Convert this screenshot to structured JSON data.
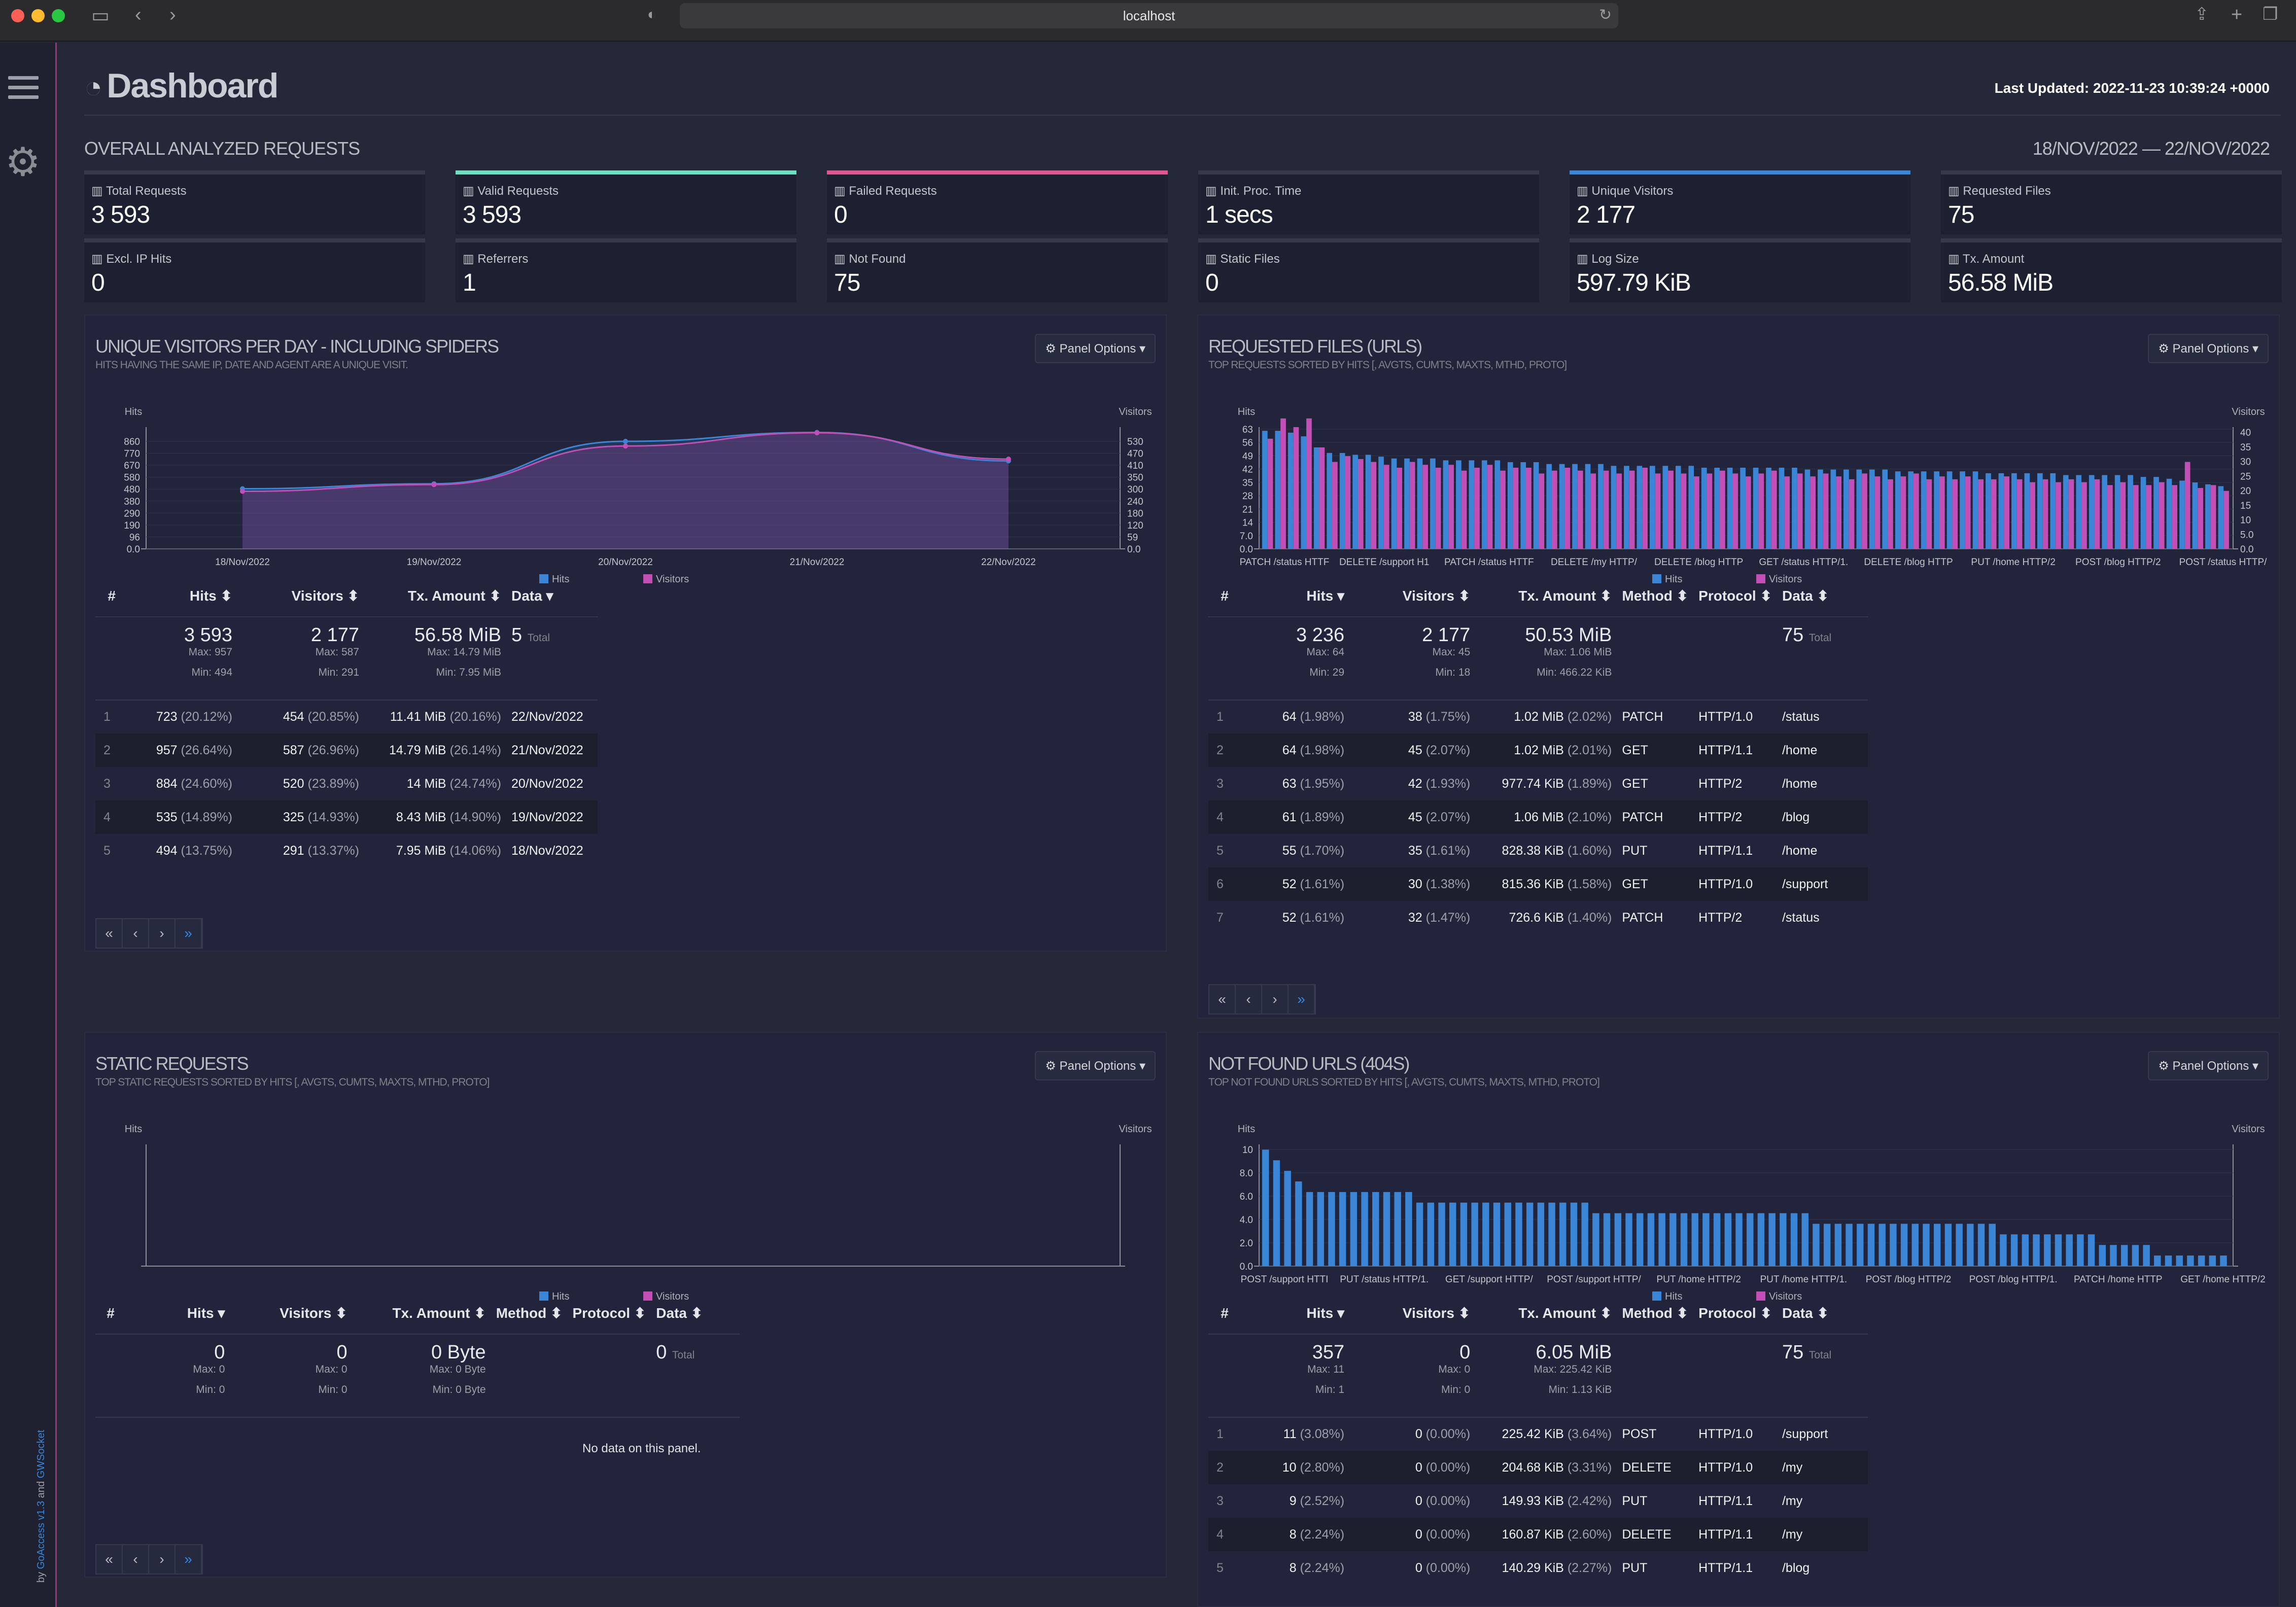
{
  "browser": {
    "url": "localhost"
  },
  "sidebar": {
    "credit_prefix": "by ",
    "credit_app": "GoAccess",
    "credit_version": "v1.3",
    "credit_and": " and ",
    "credit_ws": "GWSocket"
  },
  "header": {
    "title": "Dashboard",
    "last_updated": "Last Updated: 2022-11-23 10:39:24 +0000"
  },
  "overall": {
    "title": "OVERALL ANALYZED REQUESTS",
    "date_range": "18/NOV/2022 — 22/NOV/2022",
    "cards": [
      {
        "label": "Total Requests",
        "value": "3 593",
        "accent": "#363a4c"
      },
      {
        "label": "Valid Requests",
        "value": "3 593",
        "accent": "#6ee0bd"
      },
      {
        "label": "Failed Requests",
        "value": "0",
        "accent": "#e0578d"
      },
      {
        "label": "Init. Proc. Time",
        "value": "1 secs",
        "accent": "#363a4c"
      },
      {
        "label": "Unique Visitors",
        "value": "2 177",
        "accent": "#3a85d6"
      },
      {
        "label": "Requested Files",
        "value": "75",
        "accent": "#363a4c"
      },
      {
        "label": "Excl. IP Hits",
        "value": "0",
        "accent": "#363a4c"
      },
      {
        "label": "Referrers",
        "value": "1",
        "accent": "#363a4c"
      },
      {
        "label": "Not Found",
        "value": "75",
        "accent": "#363a4c"
      },
      {
        "label": "Static Files",
        "value": "0",
        "accent": "#363a4c"
      },
      {
        "label": "Log Size",
        "value": "597.79 KiB",
        "accent": "#363a4c"
      },
      {
        "label": "Tx. Amount",
        "value": "56.58 MiB",
        "accent": "#363a4c"
      }
    ]
  },
  "colors": {
    "hits": "#3a85d6",
    "visitors": "#c24fb5"
  },
  "panel_options_label": "⚙ Panel Options ▾",
  "visitors": {
    "title": "UNIQUE VISITORS PER DAY - INCLUDING SPIDERS",
    "subtitle": "HITS HAVING THE SAME IP, DATE AND AGENT ARE A UNIQUE VISIT.",
    "chart_data": {
      "type": "area",
      "x": [
        "18/Nov/2022",
        "19/Nov/2022",
        "20/Nov/2022",
        "21/Nov/2022",
        "22/Nov/2022"
      ],
      "series": [
        {
          "name": "Hits",
          "values": [
            494,
            535,
            884,
            957,
            723
          ]
        },
        {
          "name": "Visitors",
          "values": [
            291,
            325,
            520,
            587,
            454
          ]
        }
      ],
      "ylabel": "Hits",
      "y2label": "Visitors",
      "y_ticks": [
        "860",
        "770",
        "670",
        "580",
        "480",
        "380",
        "290",
        "190",
        "96",
        "0.0"
      ],
      "y2_ticks": [
        "530",
        "470",
        "410",
        "350",
        "300",
        "240",
        "180",
        "120",
        "59",
        "0.0"
      ]
    },
    "headers": [
      "#",
      "Hits ⬍",
      "Visitors ⬍",
      "Tx. Amount ⬍",
      "Data ▾"
    ],
    "summary": {
      "hits": "3 593",
      "hits_max": "Max: 957",
      "hits_min": "Min: 494",
      "visitors": "2 177",
      "visitors_max": "Max: 587",
      "visitors_min": "Min: 291",
      "tx": "56.58 MiB",
      "tx_max": "Max: 14.79 MiB",
      "tx_min": "Min: 7.95 MiB",
      "data": "5",
      "total": "Total"
    },
    "rows": [
      [
        "1",
        "723",
        "(20.12%)",
        "454",
        "(20.85%)",
        "11.41 MiB",
        "(20.16%)",
        "22/Nov/2022"
      ],
      [
        "2",
        "957",
        "(26.64%)",
        "587",
        "(26.96%)",
        "14.79 MiB",
        "(26.14%)",
        "21/Nov/2022"
      ],
      [
        "3",
        "884",
        "(24.60%)",
        "520",
        "(23.89%)",
        "14 MiB",
        "(24.74%)",
        "20/Nov/2022"
      ],
      [
        "4",
        "535",
        "(14.89%)",
        "325",
        "(14.93%)",
        "8.43 MiB",
        "(14.90%)",
        "19/Nov/2022"
      ],
      [
        "5",
        "494",
        "(13.75%)",
        "291",
        "(13.37%)",
        "7.95 MiB",
        "(14.06%)",
        "18/Nov/2022"
      ]
    ]
  },
  "requests": {
    "title": "REQUESTED FILES (URLS)",
    "subtitle": "TOP REQUESTS SORTED BY HITS [, AVGTS, CUMTS, MAXTS, MTHD, PROTO]",
    "chart_data": {
      "type": "bar",
      "ylabel": "Hits",
      "y2label": "Visitors",
      "y_ticks": [
        "63",
        "56",
        "49",
        "42",
        "35",
        "28",
        "21",
        "14",
        "7.0",
        "0.0"
      ],
      "y2_ticks": [
        "40",
        "35",
        "30",
        "25",
        "20",
        "15",
        "10",
        "5.0",
        "0.0"
      ],
      "x_ticks": [
        "PATCH /status HTTF",
        "DELETE /support H1",
        "PATCH /status HTTF",
        "DELETE /my HTTP/",
        "DELETE /blog HTTP",
        "GET /status HTTP/1.",
        "DELETE /blog HTTP",
        "PUT /home HTTP/2",
        "POST /blog HTTP/2",
        "POST /status HTTP/"
      ],
      "hits": [
        64,
        64,
        63,
        61,
        55,
        52,
        52,
        51,
        51,
        50,
        49,
        49,
        49,
        49,
        48,
        48,
        48,
        48,
        48,
        47,
        47,
        47,
        46,
        46,
        46,
        46,
        46,
        45,
        45,
        45,
        45,
        45,
        45,
        45,
        44,
        44,
        44,
        44,
        44,
        44,
        44,
        44,
        43,
        43,
        43,
        43,
        43,
        43,
        43,
        42,
        42,
        42,
        42,
        42,
        42,
        42,
        41,
        41,
        41,
        41,
        41,
        41,
        40,
        40,
        40,
        40,
        40,
        40,
        39,
        39,
        38,
        37,
        36,
        35,
        34
      ],
      "visitors": [
        38,
        45,
        42,
        45,
        35,
        30,
        32,
        31,
        30,
        29,
        28,
        30,
        29,
        28,
        29,
        27,
        28,
        29,
        27,
        28,
        28,
        26,
        27,
        28,
        27,
        26,
        27,
        26,
        27,
        28,
        26,
        27,
        26,
        25,
        26,
        27,
        26,
        25,
        26,
        27,
        25,
        26,
        25,
        26,
        25,
        24,
        26,
        25,
        24,
        25,
        26,
        24,
        25,
        24,
        25,
        24,
        24,
        25,
        24,
        23,
        24,
        23,
        24,
        23,
        24,
        22,
        23,
        22,
        22,
        23,
        22,
        30,
        21,
        22,
        20
      ]
    },
    "headers": [
      "#",
      "Hits ▾",
      "Visitors ⬍",
      "Tx. Amount ⬍",
      "Method ⬍",
      "Protocol ⬍",
      "Data ⬍"
    ],
    "summary": {
      "hits": "3 236",
      "hits_max": "Max: 64",
      "hits_min": "Min: 29",
      "visitors": "2 177",
      "visitors_max": "Max: 45",
      "visitors_min": "Min: 18",
      "tx": "50.53 MiB",
      "tx_max": "Max: 1.06 MiB",
      "tx_min": "Min: 466.22 KiB",
      "data": "75",
      "total": "Total"
    },
    "rows": [
      [
        "1",
        "64",
        "(1.98%)",
        "38",
        "(1.75%)",
        "1.02 MiB",
        "(2.02%)",
        "PATCH",
        "HTTP/1.0",
        "/status"
      ],
      [
        "2",
        "64",
        "(1.98%)",
        "45",
        "(2.07%)",
        "1.02 MiB",
        "(2.01%)",
        "GET",
        "HTTP/1.1",
        "/home"
      ],
      [
        "3",
        "63",
        "(1.95%)",
        "42",
        "(1.93%)",
        "977.74 KiB",
        "(1.89%)",
        "GET",
        "HTTP/2",
        "/home"
      ],
      [
        "4",
        "61",
        "(1.89%)",
        "45",
        "(2.07%)",
        "1.06 MiB",
        "(2.10%)",
        "PATCH",
        "HTTP/2",
        "/blog"
      ],
      [
        "5",
        "55",
        "(1.70%)",
        "35",
        "(1.61%)",
        "828.38 KiB",
        "(1.60%)",
        "PUT",
        "HTTP/1.1",
        "/home"
      ],
      [
        "6",
        "52",
        "(1.61%)",
        "30",
        "(1.38%)",
        "815.36 KiB",
        "(1.58%)",
        "GET",
        "HTTP/1.0",
        "/support"
      ],
      [
        "7",
        "52",
        "(1.61%)",
        "32",
        "(1.47%)",
        "726.6 KiB",
        "(1.40%)",
        "PATCH",
        "HTTP/2",
        "/status"
      ]
    ]
  },
  "static": {
    "title": "STATIC REQUESTS",
    "subtitle": "TOP STATIC REQUESTS SORTED BY HITS [, AVGTS, CUMTS, MAXTS, MTHD, PROTO]",
    "chart_data": {
      "type": "bar",
      "ylabel": "Hits",
      "y2label": "Visitors",
      "hits": [],
      "visitors": []
    },
    "headers": [
      "#",
      "Hits ▾",
      "Visitors ⬍",
      "Tx. Amount ⬍",
      "Method ⬍",
      "Protocol ⬍",
      "Data ⬍"
    ],
    "summary": {
      "hits": "0",
      "hits_max": "Max: 0",
      "hits_min": "Min: 0",
      "visitors": "0",
      "visitors_max": "Max: 0",
      "visitors_min": "Min: 0",
      "tx": "0 Byte",
      "tx_max": "Max: 0 Byte",
      "tx_min": "Min: 0 Byte",
      "data": "0",
      "total": "Total"
    },
    "no_data": "No data on this panel."
  },
  "notfound": {
    "title": "NOT FOUND URLS (404S)",
    "subtitle": "TOP NOT FOUND URLS SORTED BY HITS [, AVGTS, CUMTS, MAXTS, MTHD, PROTO]",
    "chart_data": {
      "type": "bar",
      "ylabel": "Hits",
      "y2label": "Visitors",
      "y_ticks": [
        "10",
        "8.0",
        "6.0",
        "4.0",
        "2.0",
        "0.0"
      ],
      "x_ticks": [
        "POST /support HTTI",
        "PUT /status HTTP/1.",
        "GET /support HTTP/",
        "POST /support HTTP/",
        "PUT /home HTTP/2",
        "PUT /home HTTP/1.",
        "POST /blog HTTP/2",
        "POST /blog HTTP/1.",
        "PATCH /home HTTP",
        "GET /home HTTP/2"
      ],
      "hits": [
        11,
        10,
        9,
        8,
        7,
        7,
        7,
        7,
        7,
        7,
        7,
        7,
        7,
        7,
        6,
        6,
        6,
        6,
        6,
        6,
        6,
        6,
        6,
        6,
        6,
        6,
        6,
        6,
        6,
        6,
        5,
        5,
        5,
        5,
        5,
        5,
        5,
        5,
        5,
        5,
        5,
        5,
        5,
        5,
        5,
        5,
        5,
        5,
        5,
        5,
        4,
        4,
        4,
        4,
        4,
        4,
        4,
        4,
        4,
        4,
        4,
        4,
        4,
        4,
        4,
        4,
        4,
        3,
        3,
        3,
        3,
        3,
        3,
        3,
        3,
        3,
        2,
        2,
        2,
        2,
        2,
        1,
        1,
        1,
        1,
        1,
        1,
        1
      ],
      "visitors": []
    },
    "headers": [
      "#",
      "Hits ▾",
      "Visitors ⬍",
      "Tx. Amount ⬍",
      "Method ⬍",
      "Protocol ⬍",
      "Data ⬍"
    ],
    "summary": {
      "hits": "357",
      "hits_max": "Max: 11",
      "hits_min": "Min: 1",
      "visitors": "0",
      "visitors_max": "Max: 0",
      "visitors_min": "Min: 0",
      "tx": "6.05 MiB",
      "tx_max": "Max: 225.42 KiB",
      "tx_min": "Min: 1.13 KiB",
      "data": "75",
      "total": "Total"
    },
    "rows": [
      [
        "1",
        "11",
        "(3.08%)",
        "0",
        "(0.00%)",
        "225.42 KiB",
        "(3.64%)",
        "POST",
        "HTTP/1.0",
        "/support"
      ],
      [
        "2",
        "10",
        "(2.80%)",
        "0",
        "(0.00%)",
        "204.68 KiB",
        "(3.31%)",
        "DELETE",
        "HTTP/1.0",
        "/my"
      ],
      [
        "3",
        "9",
        "(2.52%)",
        "0",
        "(0.00%)",
        "149.93 KiB",
        "(2.42%)",
        "PUT",
        "HTTP/1.1",
        "/my"
      ],
      [
        "4",
        "8",
        "(2.24%)",
        "0",
        "(0.00%)",
        "160.87 KiB",
        "(2.60%)",
        "DELETE",
        "HTTP/1.1",
        "/my"
      ],
      [
        "5",
        "8",
        "(2.24%)",
        "0",
        "(0.00%)",
        "140.29 KiB",
        "(2.27%)",
        "PUT",
        "HTTP/1.1",
        "/blog"
      ]
    ]
  },
  "legend": {
    "hits": "Hits",
    "visitors": "Visitors"
  },
  "pager": [
    "«",
    "‹",
    "›",
    "»"
  ]
}
